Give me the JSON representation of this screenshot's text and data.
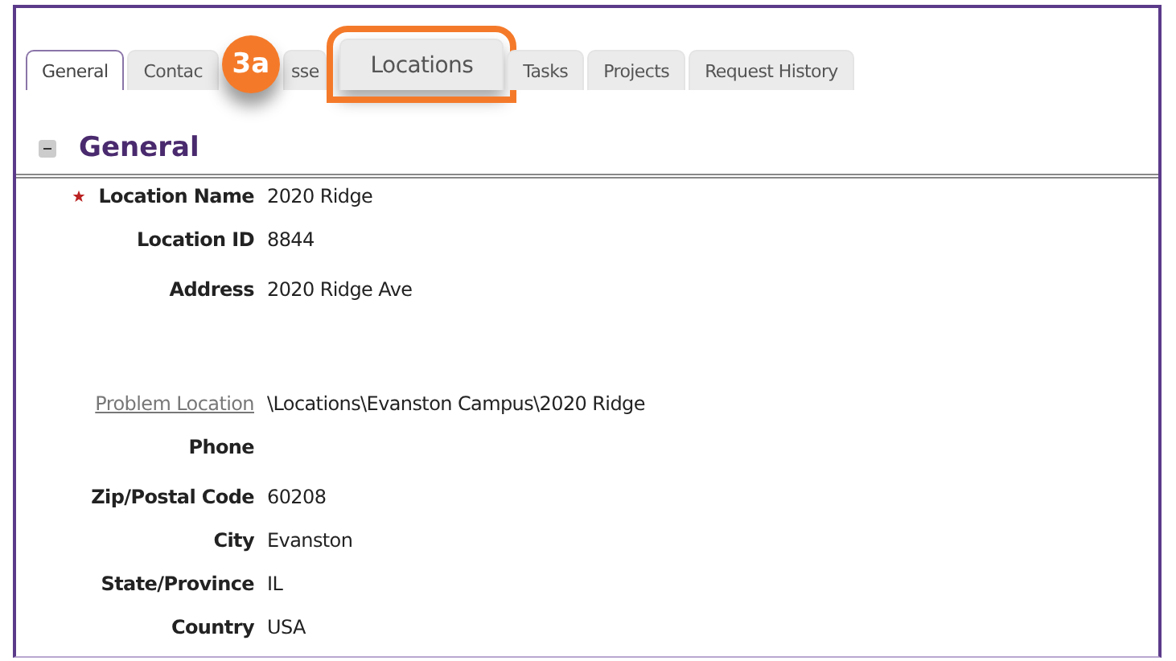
{
  "tabs": [
    {
      "label": "General",
      "selected": true,
      "highlighted": false
    },
    {
      "label": "Contac",
      "selected": false,
      "highlighted": false
    },
    {
      "label": "sse",
      "selected": false,
      "highlighted": false
    },
    {
      "label": "Locations",
      "selected": false,
      "highlighted": true
    },
    {
      "label": "Tasks",
      "selected": false,
      "highlighted": false
    },
    {
      "label": "Projects",
      "selected": false,
      "highlighted": false
    },
    {
      "label": "Request History",
      "selected": false,
      "highlighted": false
    }
  ],
  "callout": {
    "label": "3a"
  },
  "section": {
    "title": "General",
    "expanded": true
  },
  "field_groups": [
    [
      {
        "label": "Location Name",
        "value": "2020 Ridge",
        "required": true,
        "kind": "text"
      },
      {
        "label": "Location ID",
        "value": "8844",
        "required": false,
        "kind": "text"
      },
      {
        "label": "Address",
        "value": "2020 Ridge Ave",
        "required": false,
        "kind": "text"
      }
    ],
    [
      {
        "label": "Problem Location",
        "value": "\\Locations\\Evanston Campus\\2020 Ridge",
        "required": false,
        "kind": "link"
      },
      {
        "label": "Phone",
        "required": false,
        "kind": "text"
      },
      {
        "label": "Zip/Postal Code",
        "value": "60208",
        "required": false,
        "kind": "text"
      },
      {
        "label": "City",
        "value": "Evanston",
        "required": false,
        "kind": "text"
      },
      {
        "label": "State/Province",
        "value": "IL",
        "required": false,
        "kind": "text"
      },
      {
        "label": "Country",
        "value": "USA",
        "required": false,
        "kind": "text"
      }
    ]
  ]
}
